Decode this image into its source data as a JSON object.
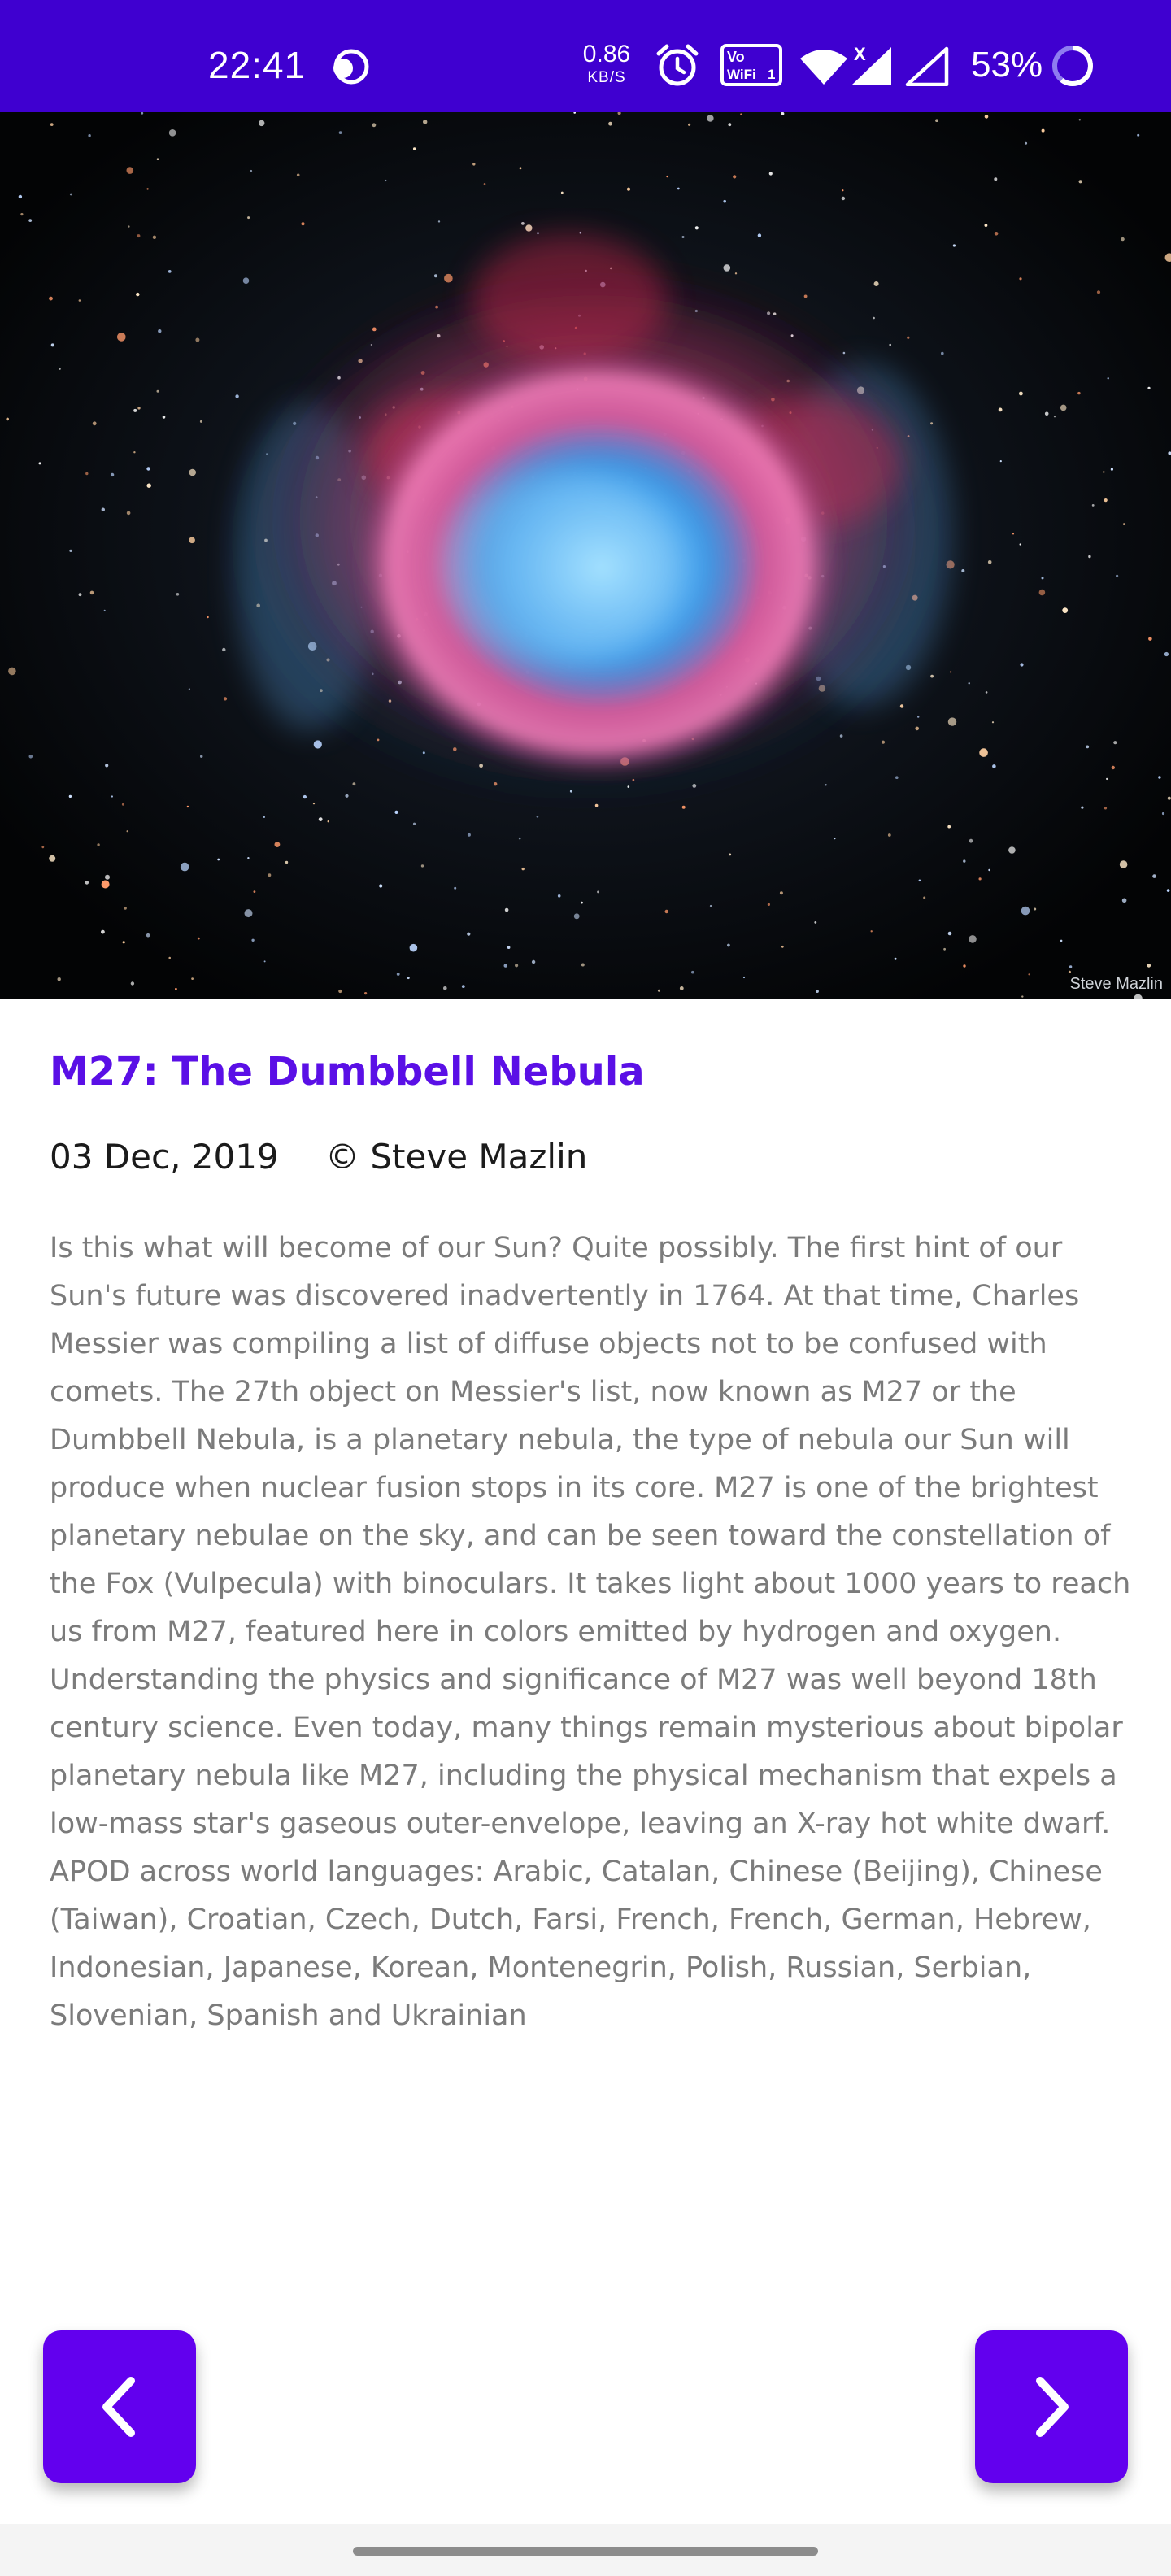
{
  "status_bar": {
    "time": "22:41",
    "net_speed_value": "0.86",
    "net_speed_unit": "KB/S",
    "battery": "53%",
    "icons": [
      "sync-icon",
      "alarm-icon",
      "vowifi-icon",
      "wifi-icon",
      "signal-icon",
      "signal-icon",
      "battery-icon"
    ],
    "vowifi_line1": "Vo",
    "vowifi_line2": "WiFi",
    "vowifi_sim": "1",
    "signal_badge": "X",
    "bg_color": "#3f00d0"
  },
  "hero": {
    "credit": "Steve Mazlin"
  },
  "apod": {
    "title": "M27: The Dumbbell Nebula",
    "date": "03 Dec, 2019",
    "copyright": "© Steve Mazlin",
    "explanation": "Is this what will become of our Sun? Quite possibly.  The first hint of our Sun's future was discovered inadvertently in 1764. At that time, Charles Messier was compiling a list of diffuse objects not to be confused with comets. The 27th object on Messier's list, now known as M27 or the Dumbbell Nebula, is a planetary nebula, the type of nebula our Sun will produce when nuclear fusion stops in its core. M27 is one of the brightest planetary nebulae on the sky, and can be seen toward the constellation of the Fox (Vulpecula) with binoculars. It takes light about 1000 years to reach us from M27, featured here in colors emitted by hydrogen and oxygen. Understanding the physics and significance of M27 was well beyond 18th century science. Even today, many things remain mysterious about bipolar planetary nebula like M27, including the physical mechanism that expels a low-mass star's gaseous outer-envelope, leaving an X-ray hot white dwarf.   APOD across world languages: Arabic, Catalan, Chinese (Beijing), Chinese (Taiwan), Croatian, Czech, Dutch, Farsi, French, French, German, Hebrew, Indonesian, Japanese, Korean, Montenegrin, Polish, Russian, Serbian, Slovenian,  Spanish and Ukrainian",
    "title_color": "#5a0fe6"
  },
  "navigation": {
    "prev_icon": "chevron-left-icon",
    "next_icon": "chevron-right-icon",
    "button_color": "#6200ee"
  }
}
